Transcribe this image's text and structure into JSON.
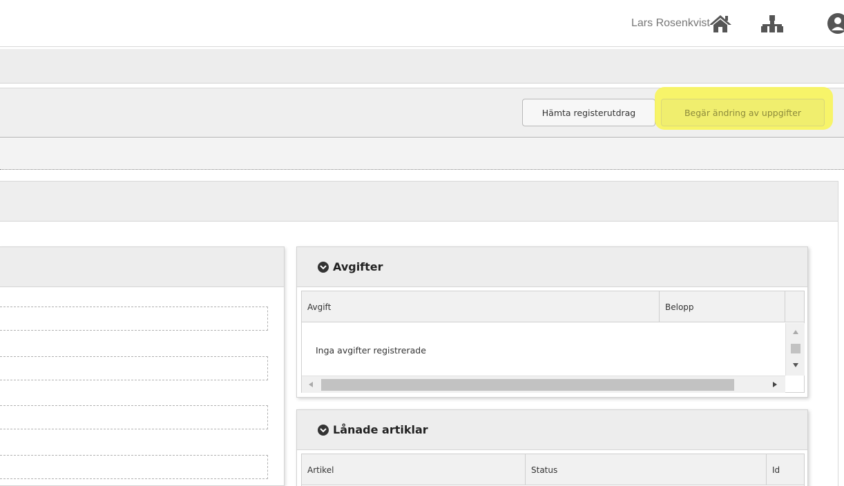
{
  "header": {
    "user_name": "Lars Rosenkvist",
    "icons": [
      "home-icon",
      "organization-icon",
      "user-icon"
    ]
  },
  "toolbar": {
    "extract_label": "Hämta registerutdrag",
    "change_label": "Begär ändring av uppgifter",
    "highlight_color": "#f7f45a"
  },
  "fees": {
    "title": "Avgifter",
    "columns": [
      "Avgift",
      "Belopp"
    ],
    "empty_message": "Inga avgifter registrerade"
  },
  "loans": {
    "title": "Lånade artiklar",
    "columns": [
      "Artikel",
      "Status",
      "Id"
    ]
  },
  "colors": {
    "panel_header": "#ededed",
    "border": "#d2d2d2",
    "text": "#333333"
  }
}
